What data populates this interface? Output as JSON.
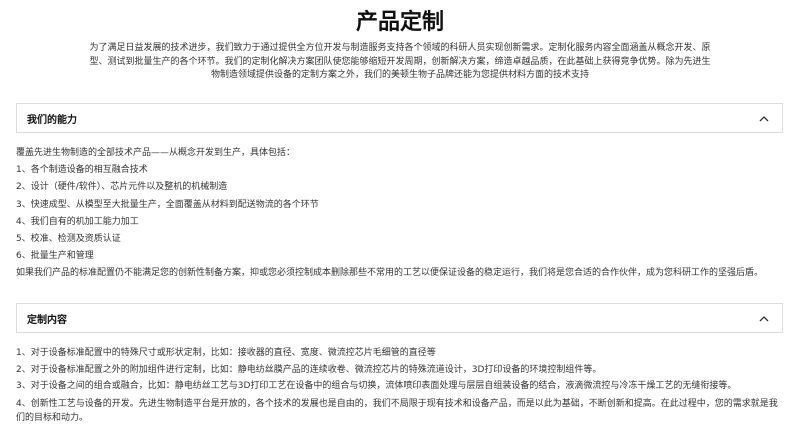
{
  "page": {
    "title": "产品定制",
    "intro": "为了满足日益发展的技术进步，我们致力于通过提供全方位开发与制造服务支持各个领域的科研人员实现创新需求。定制化服务内容全面涵盖从概念开发、原型、测试到批量生产的各个环节。我们的定制化解决方案团队使您能够缩短开发周期，创新解决方案，缔造卓越品质，在此基础上获得竞争优势。除为先进生物制造领域提供设备的定制方案之外，我们的美顿生物子品牌还能为您提供材料方面的技术支持"
  },
  "sections": [
    {
      "title": "我们的能力",
      "chevron_icon": "chevron-up-icon",
      "lines": [
        "覆盖先进生物制造的全部技术产品——从概念开发到生产，具体包括：",
        "1、各个制造设备的相互融合技术",
        "2、设计（硬件/软件）、芯片元件以及整机的机械制造",
        "3、快速成型、从模型至大批量生产，全面覆盖从材料到配送物流的各个环节",
        "4、我们自有的机加工能力加工",
        "5、校准、检测及资质认证",
        "6、批量生产和管理",
        "如果我们产品的标准配置仍不能满足您的创新性制备方案，抑或您必须控制成本删除那些不常用的工艺以便保证设备的稳定运行，我们将是您合适的合作伙伴，成为您科研工作的坚强后盾。"
      ]
    },
    {
      "title": "定制内容",
      "chevron_icon": "chevron-up-icon",
      "lines": [
        "1、对于设备标准配置中的特殊尺寸或形状定制，比如：接收器的直径、宽度、微流控芯片毛细管的直径等",
        "2、对于设备标准配置之外的附加组件进行定制，比如：静电纺丝膜产品的连续收卷、微流控芯片的特殊流道设计，3D打印设备的环境控制组件等。",
        "3、对于设备之间的组合或融合，比如：静电纺丝工艺与3D打印工艺在设备中的组合与切换，流体喷印表面处理与层层自组装设备的结合，液滴微流控与冷冻干燥工艺的无缝衔接等。",
        "4、创新性工艺与设备的开发。先进生物制造平台是开放的，各个技术的发展也是自由的，我们不局限于现有技术和设备产品，而是以此为基础，不断创新和提高。在此过程中，您的需求就是我们的目标和动力。"
      ]
    }
  ]
}
